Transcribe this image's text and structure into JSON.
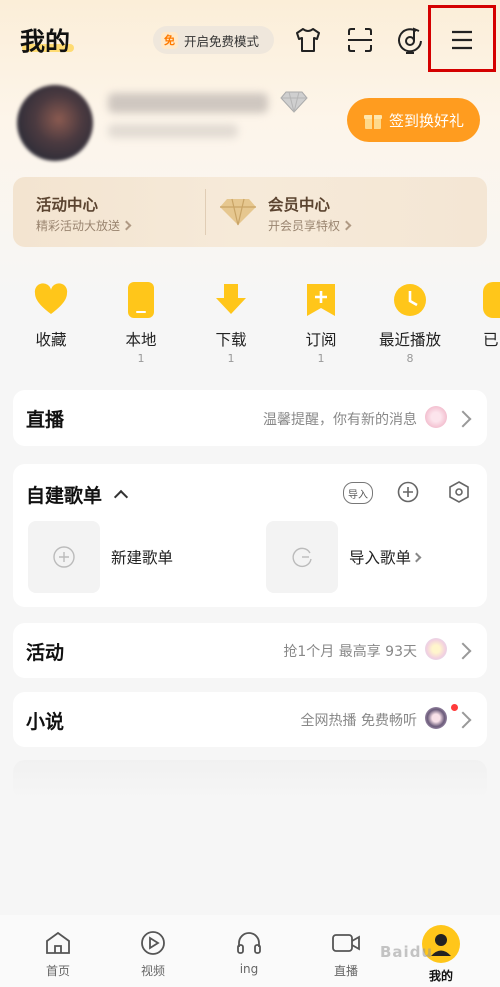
{
  "header": {
    "title": "我的",
    "free_mode_badge": "免",
    "free_mode_label": "开启免费模式",
    "icons": [
      "skin-shirt-icon",
      "scan-icon",
      "music-recognize-icon",
      "menu-icon"
    ]
  },
  "profile": {
    "signin_label": "签到换好礼"
  },
  "promo_card": {
    "activity_title": "活动中心",
    "activity_sub": "精彩活动大放送",
    "vip_title": "会员中心",
    "vip_sub": "开会员享特权"
  },
  "quick_actions": [
    {
      "label": "收藏",
      "count": "",
      "icon": "heart-icon"
    },
    {
      "label": "本地",
      "count": "1",
      "icon": "phone-icon"
    },
    {
      "label": "下载",
      "count": "1",
      "icon": "download-icon"
    },
    {
      "label": "订阅",
      "count": "1",
      "icon": "subscribe-icon"
    },
    {
      "label": "最近播放",
      "count": "8",
      "icon": "clock-icon"
    },
    {
      "label": "已",
      "count": "",
      "icon": "purchased-icon"
    }
  ],
  "live": {
    "title": "直播",
    "hint": "温馨提醒，你有新的消息"
  },
  "playlists": {
    "title": "自建歌单",
    "import_badge": "导入",
    "new_label": "新建歌单",
    "import_label": "导入歌单"
  },
  "activity": {
    "title": "活动",
    "hint": "抢1个月 最高享 93天"
  },
  "novel": {
    "title": "小说",
    "hint": "全网热播 免费畅听"
  },
  "bottom_nav": [
    {
      "label": "首页",
      "icon": "home-icon"
    },
    {
      "label": "视频",
      "icon": "video-play-icon"
    },
    {
      "label": "ing",
      "icon": "headphones-icon"
    },
    {
      "label": "直播",
      "icon": "live-camera-icon"
    },
    {
      "label": "我的",
      "icon": "profile-avatar-icon"
    }
  ],
  "colors": {
    "accent": "#ffc61a",
    "signin_bg": "#ff9c1f",
    "highlight_box": "#d40000"
  },
  "watermark": "Baidu"
}
